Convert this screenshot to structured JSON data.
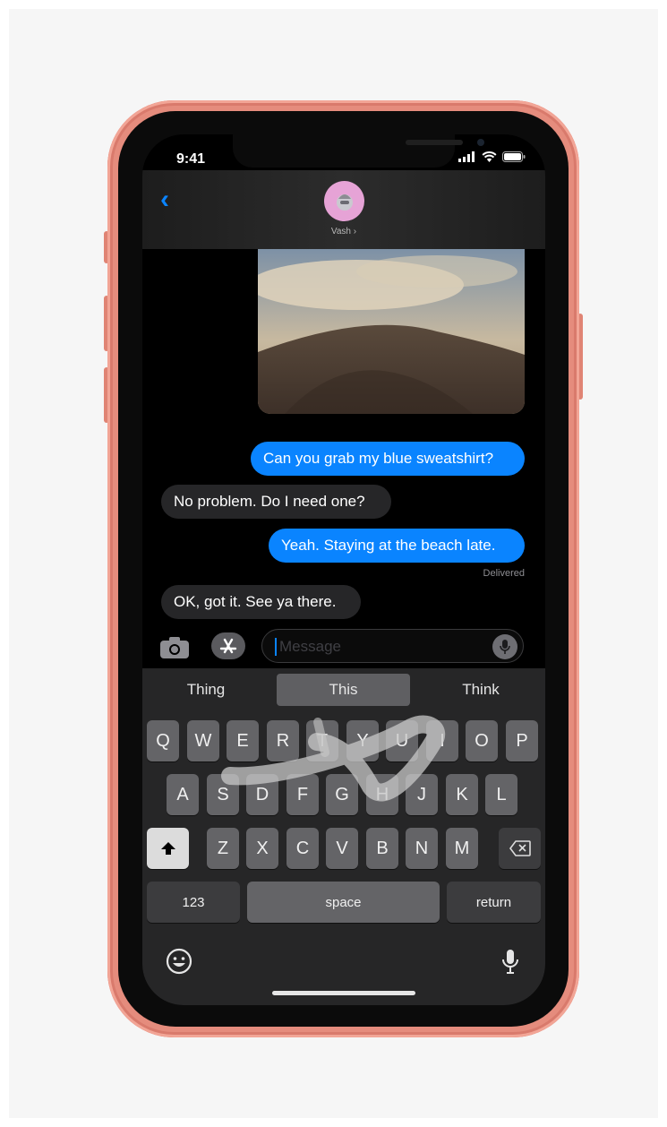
{
  "status_bar": {
    "time": "9:41"
  },
  "header": {
    "contact_name": "Vash"
  },
  "messages": [
    {
      "text": "Can you grab my blue sweatshirt?",
      "direction": "outgoing"
    },
    {
      "text": "No problem. Do I need one?",
      "direction": "incoming"
    },
    {
      "text": "Yeah. Staying at the beach late.",
      "direction": "outgoing"
    },
    {
      "text": "OK, got it. See ya there.",
      "direction": "incoming"
    }
  ],
  "delivered_label": "Delivered",
  "composer": {
    "placeholder": "Message"
  },
  "suggestions": [
    "Thing",
    "This",
    "Think"
  ],
  "keyboard": {
    "row1": [
      "Q",
      "W",
      "E",
      "R",
      "T",
      "Y",
      "U",
      "I",
      "O",
      "P"
    ],
    "row2": [
      "A",
      "S",
      "D",
      "F",
      "G",
      "H",
      "J",
      "K",
      "L"
    ],
    "row3": [
      "Z",
      "X",
      "C",
      "V",
      "B",
      "N",
      "M"
    ],
    "numbers_label": "123",
    "space_label": "space",
    "return_label": "return"
  },
  "icons": {
    "back": "chevron-left-icon",
    "camera": "camera-icon",
    "appstore": "app-store-icon",
    "mic": "microphone-icon",
    "shift": "shift-icon",
    "delete": "delete-icon",
    "emoji": "emoji-icon",
    "dictation": "dictation-icon"
  },
  "colors": {
    "outgoing_bubble": "#0a84ff",
    "incoming_bubble": "#262628",
    "phone_frame": "#e58c7d",
    "avatar": "#e6a3d6"
  }
}
